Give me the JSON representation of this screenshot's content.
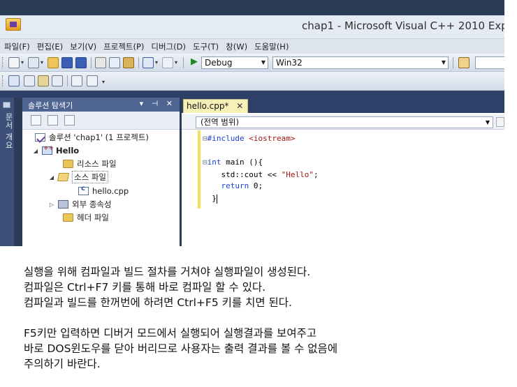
{
  "window": {
    "title": "chap1 - Microsoft Visual C++ 2010 Exp"
  },
  "menu": [
    "파일(F)",
    "편집(E)",
    "보기(V)",
    "프로젝트(P)",
    "디버그(D)",
    "도구(T)",
    "창(W)",
    "도움말(H)"
  ],
  "toolbar": {
    "configuration": "Debug",
    "platform": "Win32"
  },
  "side_tab": {
    "label": "문서 개요"
  },
  "solution_explorer": {
    "title": "솔루션 탐색기",
    "header_controls": "▾ ⊣ ✕",
    "tree": [
      {
        "label": "솔루션 'chap1' (1 프로젝트)",
        "icon": "solution-icon"
      },
      {
        "label": "Hello",
        "icon": "project-icon"
      },
      {
        "label": "리소스 파일",
        "icon": "folder-icon"
      },
      {
        "label": "소스 파일",
        "icon": "folder-open-icon"
      },
      {
        "label": "hello.cpp",
        "icon": "cpp-file-icon"
      },
      {
        "label": "외부 종속성",
        "icon": "dependencies-icon"
      },
      {
        "label": "헤더 파일",
        "icon": "folder-icon"
      }
    ]
  },
  "editor": {
    "tab_label": "hello.cpp*",
    "tab_close": "✕",
    "scope": "(전역 범위)",
    "code": {
      "l1_prefix": "#include ",
      "l1_header": "<iostream>",
      "l3_kw": "int",
      "l3_rest": " main (){",
      "l4_pre": "    std::cout << ",
      "l4_str": "\"Hello\"",
      "l4_post": ";",
      "l5_kw": "return",
      "l5_rest": " 0;",
      "l6": "}"
    }
  },
  "notes": [
    "실행을 위해 컴파일과 빌드 절차를 거쳐야 실행파일이 생성된다.",
    "컴파일은 Ctrl+F7 키를 통해 바로 컴파일 할 수 있다.",
    "컴파일과 빌드를 한꺼번에 하려면 Ctrl+F5 키를 치면 된다.",
    "F5키만 입력하면 디버거 모드에서 실행되어 실행결과를 보여주고",
    "바로 DOS윈도우를 닫아 버리므로 사용자는 출력 결과를 볼 수 없음에",
    "주의하기 바란다."
  ]
}
